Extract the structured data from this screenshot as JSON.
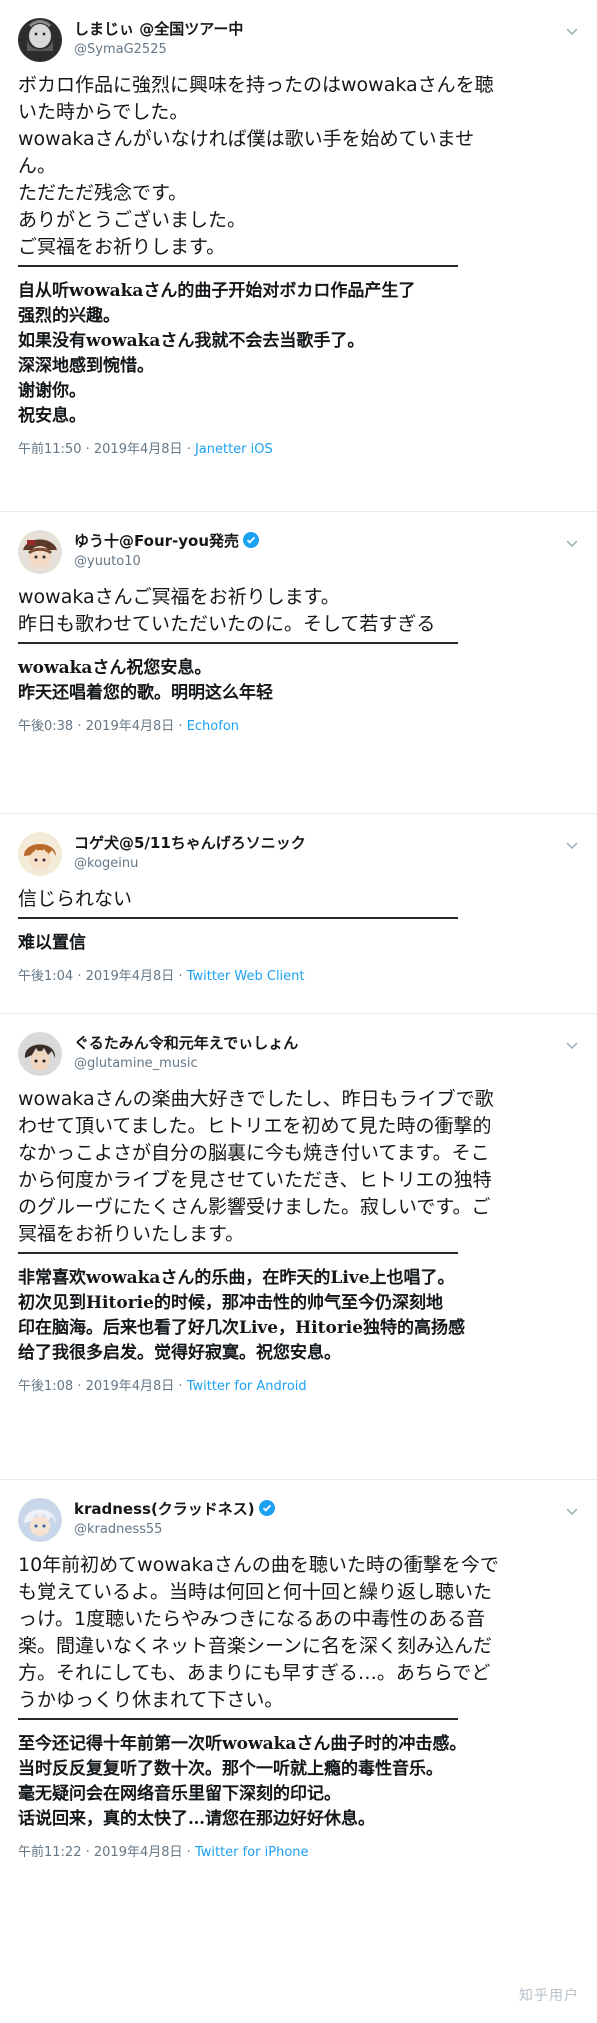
{
  "tweets": [
    {
      "display_name": "しまじぃ @全国ツアー中",
      "handle": "@SymaG2525",
      "verified": false,
      "avatar_icon": "avatar-face-beard-icon",
      "text": "ボカロ作品に強烈に興味を持ったのはwowakaさんを聴\nいた時からでした。\nwowakaさんがいなければ僕は歌い手を始めていませ\nん。\nただただ残念です。\nありがとうございました。\nご冥福をお祈りします。",
      "translation": "自从听wowakaさん的曲子开始对ボカロ作品产生了\n强烈的兴趣。\n如果没有wowakaさん我就不会去当歌手了。\n深深地感到惋惜。\n谢谢你。\n祝安息。",
      "time": "午前11:50",
      "date": "2019年4月8日",
      "source": "Janetter iOS"
    },
    {
      "display_name": "ゆう十@Four-you発売",
      "handle": "@yuuto10",
      "verified": true,
      "avatar_icon": "avatar-anime-hat-icon",
      "text": "wowakaさんご冥福をお祈りします。\n昨日も歌わせていただいたのに。そして若すぎる",
      "translation": "wowakaさん祝您安息。\n昨天还唱着您的歌。明明这么年轻",
      "time": "午後0:38",
      "date": "2019年4月8日",
      "source": "Echofon"
    },
    {
      "display_name": "コゲ犬@5/11ちゃんげろソニック",
      "handle": "@kogeinu",
      "verified": false,
      "avatar_icon": "avatar-anime-brown-hair-icon",
      "text": "信じられない",
      "translation": "难以置信",
      "time": "午後1:04",
      "date": "2019年4月8日",
      "source": "Twitter Web Client"
    },
    {
      "display_name": "ぐるたみん令和元年えでぃしょん",
      "handle": "@glutamine_music",
      "verified": false,
      "avatar_icon": "avatar-anime-dark-hair-icon",
      "text": "wowakaさんの楽曲大好きでしたし、昨日もライブで歌\nわせて頂いてました。ヒトリエを初めて見た時の衝撃的\nなかっこよさが自分の脳裏に今も焼き付いてます。そこ\nから何度かライブを見させていただき、ヒトリエの独特\nのグルーヴにたくさん影響受けました。寂しいです。ご\n冥福をお祈りいたします。",
      "translation": "非常喜欢wowakaさん的乐曲，在昨天的Live上也唱了。\n初次见到Hitorie的时候，那冲击性的帅气至今仍深刻地\n印在脑海。后来也看了好几次Live，Hitorie独特的高扬感\n给了我很多启发。觉得好寂寞。祝您安息。",
      "time": "午後1:08",
      "date": "2019年4月8日",
      "source": "Twitter for Android"
    },
    {
      "display_name": "kradness(クラッドネス)",
      "handle": "@kradness55",
      "verified": true,
      "avatar_icon": "avatar-anime-silver-hair-icon",
      "text": "10年前初めてwowakaさんの曲を聴いた時の衝撃を今で\nも覚えているよ。当時は何回と何十回と繰り返し聴いた\nっけ。1度聴いたらやみつきになるあの中毒性のある音\n楽。間違いなくネット音楽シーンに名を深く刻み込んだ\n方。それにしても、あまりにも早すぎる…。あちらでど\nうかゆっくり休まれて下さい。",
      "translation": "至今还记得十年前第一次听wowakaさん曲子时的冲击感。\n当时反反复复听了数十次。那个一听就上瘾的毒性音乐。\n毫无疑问会在网络音乐里留下深刻的印记。\n话说回来，真的太快了…请您在那边好好休息。",
      "time": "午前11:22",
      "date": "2019年4月8日",
      "source": "Twitter for iPhone"
    }
  ],
  "separator": "·",
  "watermark": "知乎用户",
  "colors": {
    "text": "#14171a",
    "meta": "#657786",
    "accent": "#1da1f2",
    "border": "#e6ecf0"
  }
}
